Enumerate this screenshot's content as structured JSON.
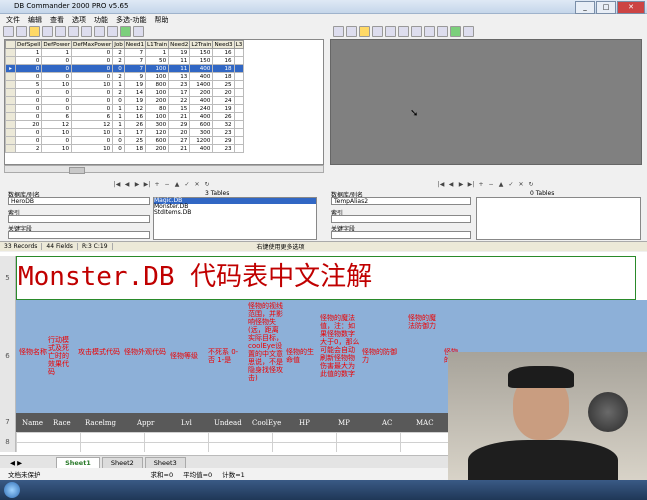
{
  "window": {
    "title": "DB Commander 2000 PRO v5.65"
  },
  "menu": [
    "文件",
    "编辑",
    "查看",
    "选项",
    "功能",
    "多选-功能",
    "帮助"
  ],
  "grid": {
    "columns": [
      "DefSpell",
      "DefPower",
      "DefMaxPower",
      "Job",
      "Need1",
      "L1Train",
      "Need2",
      "L2Train",
      "Need3",
      "L3"
    ],
    "rows": [
      [
        "1",
        "0",
        "2",
        "7",
        "1",
        "19",
        "150",
        "16"
      ],
      [
        "0",
        "0",
        "2",
        "7",
        "50",
        "11",
        "150",
        "16"
      ],
      [
        "0",
        "0",
        "0",
        "7",
        "100",
        "11",
        "400",
        "18"
      ],
      [
        "0",
        "0",
        "2",
        "9",
        "100",
        "13",
        "400",
        "18"
      ],
      [
        "10",
        "10",
        "1",
        "19",
        "800",
        "23",
        "1400",
        "25"
      ],
      [
        "0",
        "0",
        "2",
        "14",
        "100",
        "17",
        "200",
        "20"
      ],
      [
        "0",
        "0",
        "0",
        "19",
        "200",
        "22",
        "400",
        "24"
      ],
      [
        "0",
        "0",
        "1",
        "12",
        "80",
        "15",
        "240",
        "19"
      ],
      [
        "6",
        "6",
        "1",
        "16",
        "100",
        "21",
        "400",
        "26"
      ],
      [
        "12",
        "12",
        "1",
        "26",
        "300",
        "29",
        "600",
        "32"
      ],
      [
        "10",
        "10",
        "1",
        "17",
        "120",
        "20",
        "300",
        "23"
      ],
      [
        "0",
        "0",
        "0",
        "25",
        "600",
        "27",
        "1200",
        "29"
      ],
      [
        "10",
        "10",
        "0",
        "18",
        "200",
        "21",
        "400",
        "23"
      ]
    ],
    "lead": [
      "1",
      "0",
      "0",
      "0",
      "5",
      "0",
      "0",
      "0",
      "0",
      "20",
      "0",
      "0",
      "2"
    ]
  },
  "left_panel": {
    "alias_label": "数据库/别名",
    "alias_value": "HeroDB",
    "index_label": "索引",
    "key_label": "关键字段",
    "tables_count": "3 Tables",
    "tables": [
      "Magic.DB",
      "Monster.DB",
      "StdItems.DB"
    ]
  },
  "right_panel": {
    "alias_label": "数据库/别名",
    "alias_value": "TempAlias2",
    "index_label": "索引",
    "key_label": "关键字段",
    "tables_count": "0 Tables"
  },
  "status": {
    "records": "33 Records",
    "fields": "44 Fields",
    "pos": "R:3 C:19",
    "hint": "右键使用更多选项"
  },
  "sheet": {
    "title": "Monster.DB 代码表中文注解",
    "row5": "5",
    "row6": "6",
    "row7": "7",
    "row8": "8",
    "notes": [
      "怪物名称",
      "行动模式及死亡时的效果代码",
      "攻击模式代码",
      "怪物外观代码",
      "怪物等级",
      "不死系 0-否 1-是",
      "怪物的视线范围，并影响怪物失(远，距离实际目标，coolEye设置的中文意思说，不是隐身找怪攻击)",
      "怪物的生命值",
      "怪物的魔法值，注：如果怪物数字大于0，那么可能会自动刷新怪物物伤害最大为此值的数字",
      "怪物的防御力",
      "怪物的魔法防御力",
      "怪物的..."
    ],
    "headers": [
      "Name",
      "Race",
      "Racelmg",
      "Appr",
      "Lvl",
      "Undead",
      "CoolEye",
      "HP",
      "MP",
      "AC",
      "MAC"
    ],
    "tabs": [
      "Sheet1",
      "Sheet2",
      "Sheet3"
    ],
    "xl_status": {
      "protect": "文档未保护",
      "sum": "求和=0",
      "avg": "平均值=0",
      "count": "计数=1"
    }
  }
}
